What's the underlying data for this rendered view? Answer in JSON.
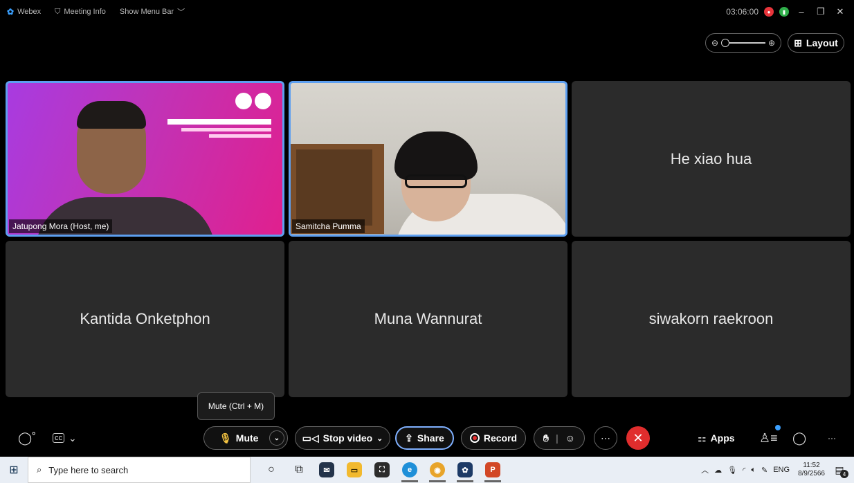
{
  "topbar": {
    "app_name": "Webex",
    "meeting_info": "Meeting Info",
    "show_menu_bar": "Show Menu Bar",
    "timer": "03:06:00"
  },
  "view": {
    "layout_label": "Layout"
  },
  "participants": [
    {
      "name": "Jatupong Mora (Host, me)",
      "video": true
    },
    {
      "name": "Samitcha Pumma",
      "video": true
    },
    {
      "name": "He xiao hua",
      "video": false
    },
    {
      "name": "Kantida Onketphon",
      "video": false
    },
    {
      "name": "Muna Wannurat",
      "video": false
    },
    {
      "name": "siwakorn raekroon",
      "video": false
    }
  ],
  "controls": {
    "tooltip": "Mute (Ctrl + M)",
    "mute_label": "Mute",
    "stop_video_label": "Stop video",
    "share_label": "Share",
    "record_label": "Record",
    "apps_label": "Apps"
  },
  "taskbar": {
    "search_placeholder": "Type here to search",
    "language": "ENG",
    "time": "11:52",
    "date": "8/9/2566",
    "notification_count": "4"
  },
  "colors": {
    "active_speaker_border": "#5d9ff0",
    "end_call": "#e02d2d",
    "tile_bg": "#2b2b2b"
  }
}
